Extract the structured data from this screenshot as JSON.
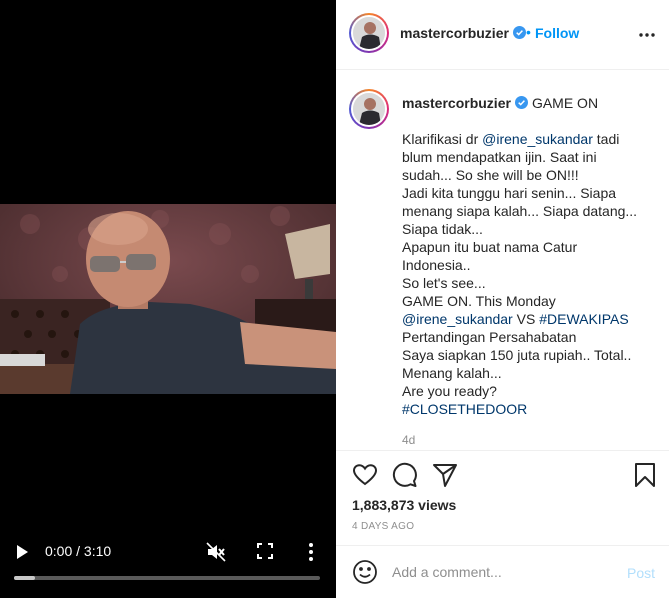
{
  "video": {
    "time_display": "0:00 / 3:10",
    "progress_fraction": 0.07
  },
  "post": {
    "username": "mastercorbuzier",
    "dot": "•",
    "follow_label": "Follow",
    "caption_title": "GAME ON",
    "caption_lines": [
      [
        {
          "t": "Klarifikasi dr "
        },
        {
          "t": "@irene_sukandar",
          "link": true
        },
        {
          "t": " tadi"
        }
      ],
      [
        {
          "t": "blum mendapatkan ijin. Saat ini"
        }
      ],
      [
        {
          "t": "sudah... So she will be ON!!!"
        }
      ],
      [
        {
          "t": "Jadi kita tunggu hari senin... Siapa"
        }
      ],
      [
        {
          "t": "menang siapa kalah... Siapa datang..."
        }
      ],
      [
        {
          "t": "Siapa tidak..."
        }
      ],
      [
        {
          "t": "Apapun itu buat nama Catur"
        }
      ],
      [
        {
          "t": "Indonesia.."
        }
      ],
      [
        {
          "t": "So let's see..."
        }
      ],
      [
        {
          "t": "GAME ON. This Monday"
        }
      ],
      [
        {
          "t": "@irene_sukandar",
          "link": true
        },
        {
          "t": " VS "
        },
        {
          "t": "#DEWAKIPAS",
          "link": true
        }
      ],
      [
        {
          "t": "Pertandingan Persahabatan"
        }
      ],
      [
        {
          "t": "Saya siapkan 150 juta rupiah.. Total.."
        }
      ],
      [
        {
          "t": "Menang kalah..."
        }
      ],
      [
        {
          "t": "Are you ready?"
        }
      ],
      [
        {
          "t": "#CLOSETHEDOOR",
          "link": true
        }
      ]
    ],
    "caption_age": "4d",
    "views": "1,883,873 views",
    "date": "4 DAYS AGO",
    "comment_placeholder": "Add a comment...",
    "post_label": "Post"
  },
  "icons": {
    "video": [
      "play-icon",
      "muted-icon",
      "fullscreen-icon",
      "more-vertical-icon"
    ],
    "actions": [
      "heart-icon",
      "comment-icon",
      "share-icon",
      "bookmark-icon",
      "emoji-icon",
      "verified-icon",
      "more-horizontal-icon"
    ]
  },
  "colors": {
    "link": "#00376b",
    "follow": "#0095f6",
    "verified": "#3897f0",
    "post_disabled": "#b2dffc",
    "muted_text": "#8e8e8e"
  }
}
